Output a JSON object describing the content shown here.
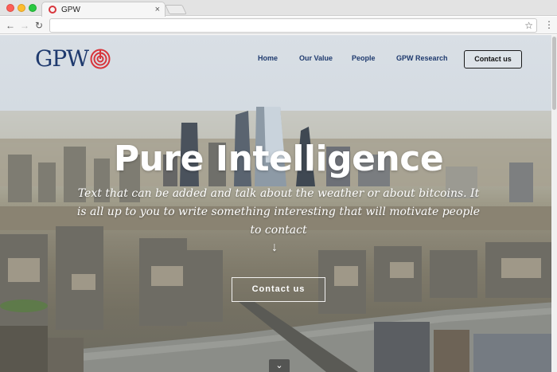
{
  "browser": {
    "tab_title": "GPW",
    "tab_close": "×",
    "back": "←",
    "forward": "→",
    "reload": "↻",
    "star": "☆",
    "menu": "⋮"
  },
  "site": {
    "logo_text": "GPW",
    "brand_colors": {
      "navy": "#1f3a6e",
      "red": "#d8353c"
    },
    "nav": {
      "items": [
        "Home",
        "Our Value",
        "People",
        "GPW Research"
      ],
      "contact_label": "Contact us"
    },
    "hero": {
      "title": "Pure Intelligence",
      "subtitle": "Text that can be added and talk about the weather or about bitcoins. It is all up to you to write something interesting that will motivate people to contact",
      "arrow": "↓",
      "cta_label": "Contact us",
      "scroll_icon": "⌄"
    }
  }
}
